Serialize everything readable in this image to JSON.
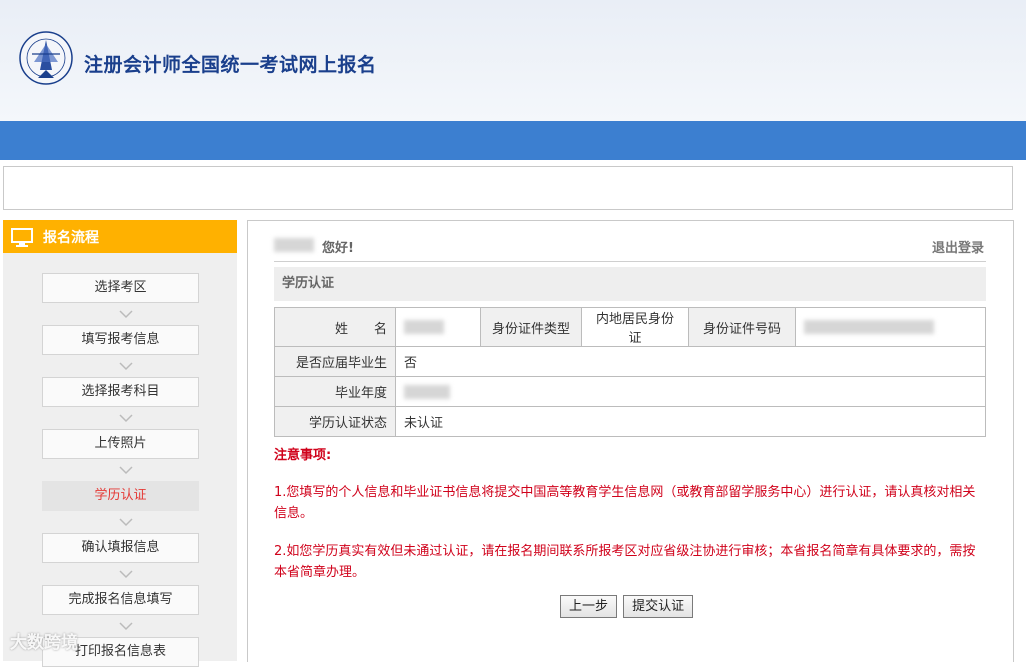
{
  "header": {
    "title": "注册会计师全国统一考试网上报名"
  },
  "sidebar": {
    "title": "报名流程",
    "steps": [
      {
        "label": "选择考区"
      },
      {
        "label": "填写报考信息"
      },
      {
        "label": "选择报考科目"
      },
      {
        "label": "上传照片"
      },
      {
        "label": "学历认证",
        "active": true
      },
      {
        "label": "确认填报信息"
      },
      {
        "label": "完成报名信息填写"
      },
      {
        "label": "打印报名信息表"
      }
    ]
  },
  "main": {
    "greeting": "您好!",
    "logout": "退出登录",
    "section_title": "学历认证",
    "table": {
      "name_label": "姓　　名",
      "id_type_label": "身份证件类型",
      "id_type_value": "内地居民身份证",
      "id_number_label": "身份证件号码",
      "graduate_label": "是否应届毕业生",
      "graduate_value": "否",
      "grad_year_label": "毕业年度",
      "cert_status_label": "学历认证状态",
      "cert_status_value": "未认证"
    },
    "notes_title": "注意事项:",
    "note1": "1.您填写的个人信息和毕业证书信息将提交中国高等教育学生信息网（或教育部留学服务中心）进行认证，请认真核对相关信息。",
    "note2": "2.如您学历真实有效但未通过认证，请在报名期间联系所报考区对应省级注协进行审核；本省报名简章有具体要求的，需按本省简章办理。",
    "prev_button": "上一步",
    "submit_button": "提交认证"
  },
  "watermark": "大数跨境"
}
